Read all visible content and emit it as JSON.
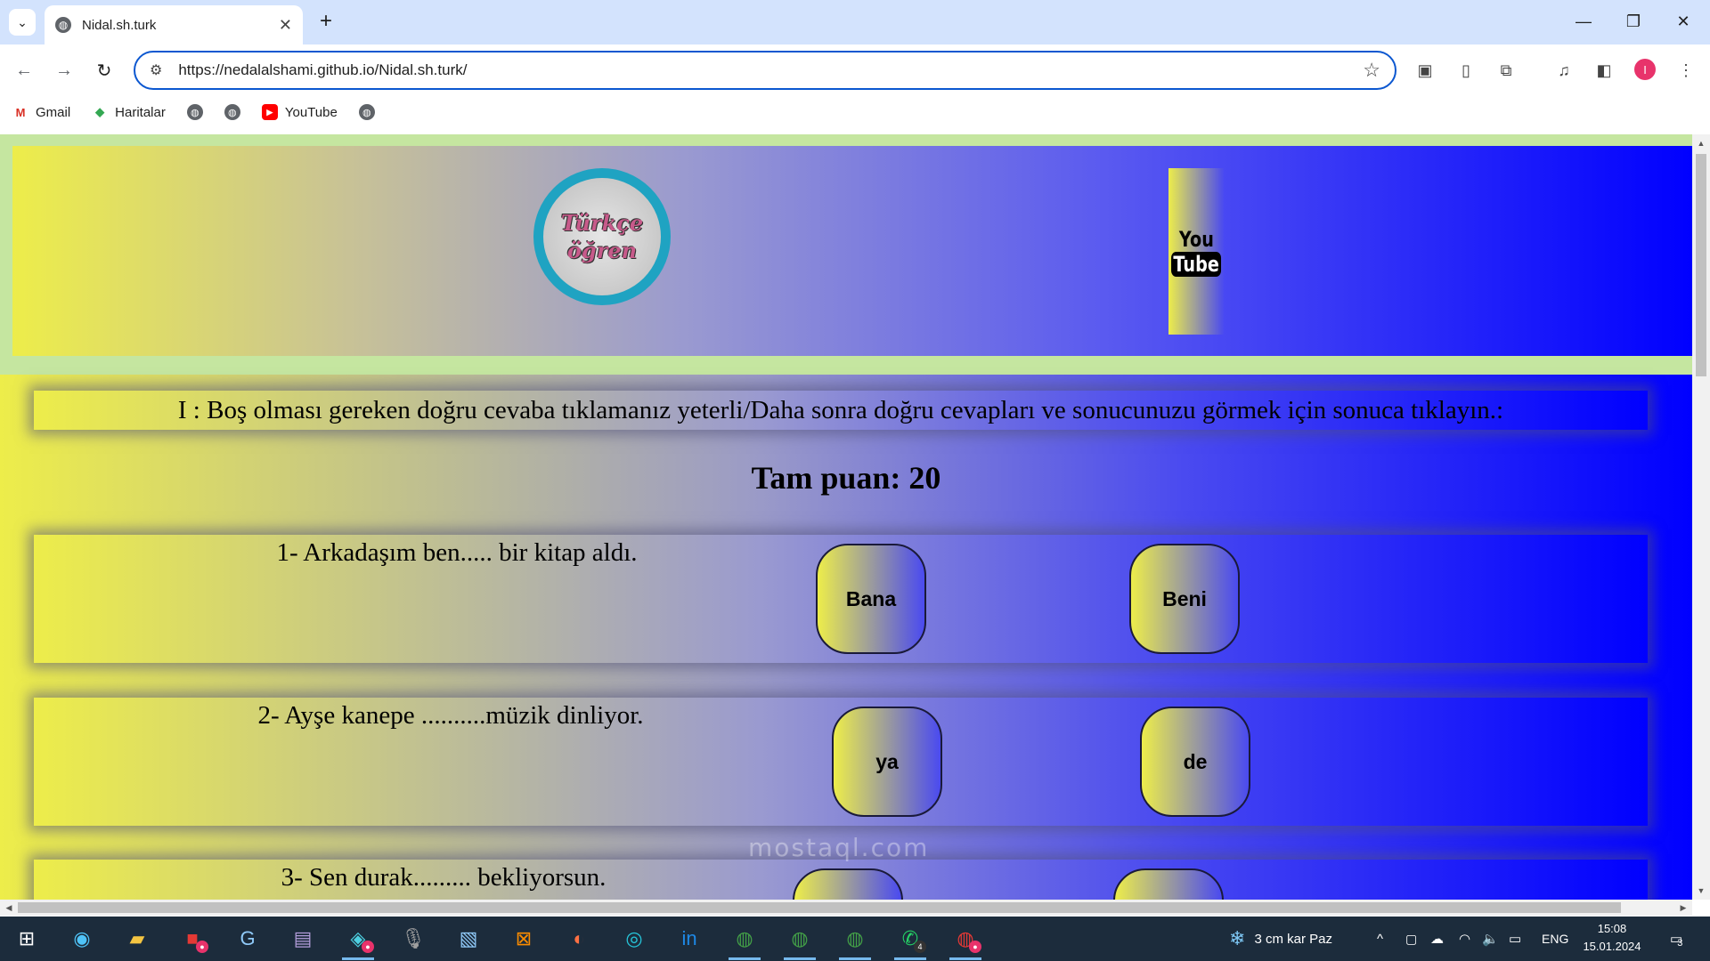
{
  "browser": {
    "tab_title": "Nidal.sh.turk",
    "tab_close": "✕",
    "new_tab": "+",
    "url": "https://nedalalshami.github.io/Nidal.sh.turk/",
    "bookmarks": [
      {
        "label": "Gmail",
        "icon": "gmail-icon"
      },
      {
        "label": "Haritalar",
        "icon": "maps-icon"
      },
      {
        "label": "",
        "icon": "globe-icon"
      },
      {
        "label": "",
        "icon": "globe-icon"
      },
      {
        "label": "YouTube",
        "icon": "youtube-icon"
      },
      {
        "label": "",
        "icon": "globe-icon"
      }
    ],
    "profile_initial": "I"
  },
  "page": {
    "logo": {
      "line1": "Türkçe",
      "line2": "öğren"
    },
    "youtube_tile": {
      "line1": "You",
      "line2": "Tube"
    },
    "instruction": "I : Boş olması gereken doğru cevaba tıklamanız yeterli/Daha sonra doğru cevapları ve sonucunuzu görmek için sonuca tıklayın.:",
    "score": "Tam puan: 20",
    "questions": [
      {
        "text": "1- Arkadaşım ben..... bir kitap aldı.",
        "options": [
          "Bana",
          "Beni"
        ]
      },
      {
        "text": "2- Ayşe kanepe ..........müzik dinliyor.",
        "options": [
          "ya",
          "de"
        ]
      },
      {
        "text": "3- Sen durak......... bekliyorsun.",
        "options": [
          "",
          ""
        ]
      }
    ],
    "watermark": "mostaql.com"
  },
  "taskbar": {
    "weather": "3 cm kar Paz",
    "language": "ENG",
    "time": "15:08",
    "date": "15.01.2024",
    "whatsapp_badge": "4",
    "notification_count": "3"
  },
  "colors": {
    "gradient_start": "#eded4a",
    "gradient_end": "#0000ff",
    "logo_ring": "#1fa3c2",
    "header_border": "#c5e6a0"
  }
}
